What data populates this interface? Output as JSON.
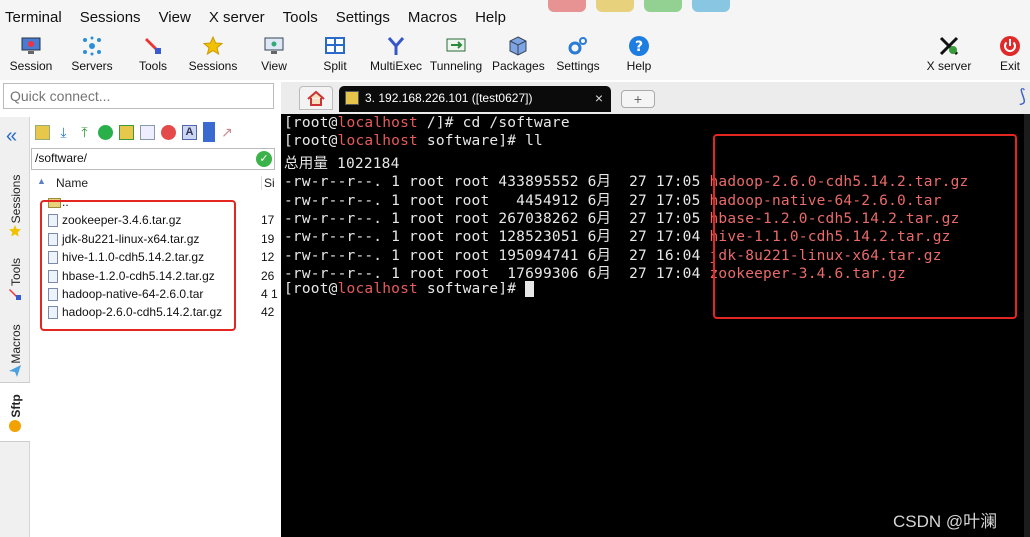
{
  "menu": [
    "Terminal",
    "Sessions",
    "View",
    "X server",
    "Tools",
    "Settings",
    "Macros",
    "Help"
  ],
  "toolbar": {
    "session": "Session",
    "servers": "Servers",
    "tools": "Tools",
    "sessions": "Sessions",
    "view": "View",
    "split": "Split",
    "multiexec": "MultiExec",
    "tunneling": "Tunneling",
    "packages": "Packages",
    "settings": "Settings",
    "help": "Help",
    "xserver": "X server",
    "exit": "Exit"
  },
  "quick_connect": {
    "placeholder": "Quick connect..."
  },
  "tab": {
    "title": "3. 192.168.226.101 ([test0627])",
    "close": "×",
    "new": "+"
  },
  "side_tabs": {
    "sessions": "Sessions",
    "tools": "Tools",
    "macros": "Macros",
    "sftp": "Sftp"
  },
  "sftp": {
    "path": "/software/",
    "col_name": "Name",
    "col_size": "Si",
    "parent": "..",
    "files": [
      {
        "name": "zookeeper-3.4.6.tar.gz",
        "size": "17"
      },
      {
        "name": "jdk-8u221-linux-x64.tar.gz",
        "size": "19"
      },
      {
        "name": "hive-1.1.0-cdh5.14.2.tar.gz",
        "size": "12"
      },
      {
        "name": "hbase-1.2.0-cdh5.14.2.tar.gz",
        "size": "26"
      },
      {
        "name": "hadoop-native-64-2.6.0.tar",
        "size": "4 1"
      },
      {
        "name": "hadoop-2.6.0-cdh5.14.2.tar.gz",
        "size": "42"
      }
    ]
  },
  "terminal": {
    "user": "[root@",
    "host": "localhost",
    "prompt1_rest": " /]# cd /software",
    "prompt2_rest": " software]# ll",
    "total": "总用量 1022184",
    "listing": [
      {
        "meta": "-rw-r--r--. 1 root root 433895552 6月  27 17:05 ",
        "file": "hadoop-2.6.0-cdh5.14.2.tar.gz"
      },
      {
        "meta": "-rw-r--r--. 1 root root   4454912 6月  27 17:05 ",
        "file": "hadoop-native-64-2.6.0.tar"
      },
      {
        "meta": "-rw-r--r--. 1 root root 267038262 6月  27 17:05 ",
        "file": "hbase-1.2.0-cdh5.14.2.tar.gz"
      },
      {
        "meta": "-rw-r--r--. 1 root root 128523051 6月  27 17:04 ",
        "file": "hive-1.1.0-cdh5.14.2.tar.gz"
      },
      {
        "meta": "-rw-r--r--. 1 root root 195094741 6月  27 16:04 ",
        "file": "jdk-8u221-linux-x64.tar.gz"
      },
      {
        "meta": "-rw-r--r--. 1 root root  17699306 6月  27 17:04 ",
        "file": "zookeeper-3.4.6.tar.gz"
      }
    ],
    "prompt3_rest": " software]# "
  },
  "watermark": "CSDN @叶澜",
  "colors": {
    "highlight_box": "#e3261f",
    "host_red": "#e65c5c",
    "terminal_bg": "#000000"
  }
}
